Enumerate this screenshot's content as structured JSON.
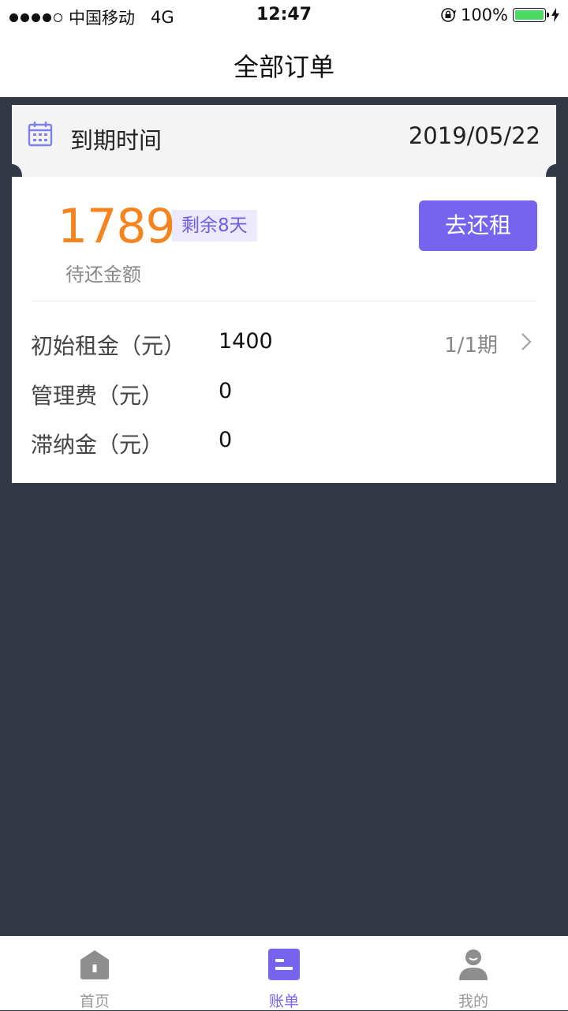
{
  "status_bar": {
    "carrier": "中国移动",
    "network": "4G",
    "time": "12:47",
    "battery": "100%"
  },
  "nav": {
    "title": "全部订单"
  },
  "order": {
    "due_label": "到期时间",
    "due_date": "2019/05/22",
    "amount": "1789",
    "remaining_days": "剩余8天",
    "amount_label": "待还金额",
    "pay_button": "去还租",
    "details": [
      {
        "label": "初始租金（元）",
        "value": "1400",
        "period": "1/1期"
      },
      {
        "label": "管理费（元）",
        "value": "0"
      },
      {
        "label": "滞纳金（元）",
        "value": "0"
      }
    ]
  },
  "tab_bar": {
    "tabs": [
      {
        "label": "首页",
        "icon": "home-icon"
      },
      {
        "label": "账单",
        "icon": "bill-icon"
      },
      {
        "label": "我的",
        "icon": "profile-icon"
      }
    ],
    "active": "账单"
  },
  "colors": {
    "accent": "#7664ef",
    "amount": "#f5841f",
    "background": "#333845"
  }
}
